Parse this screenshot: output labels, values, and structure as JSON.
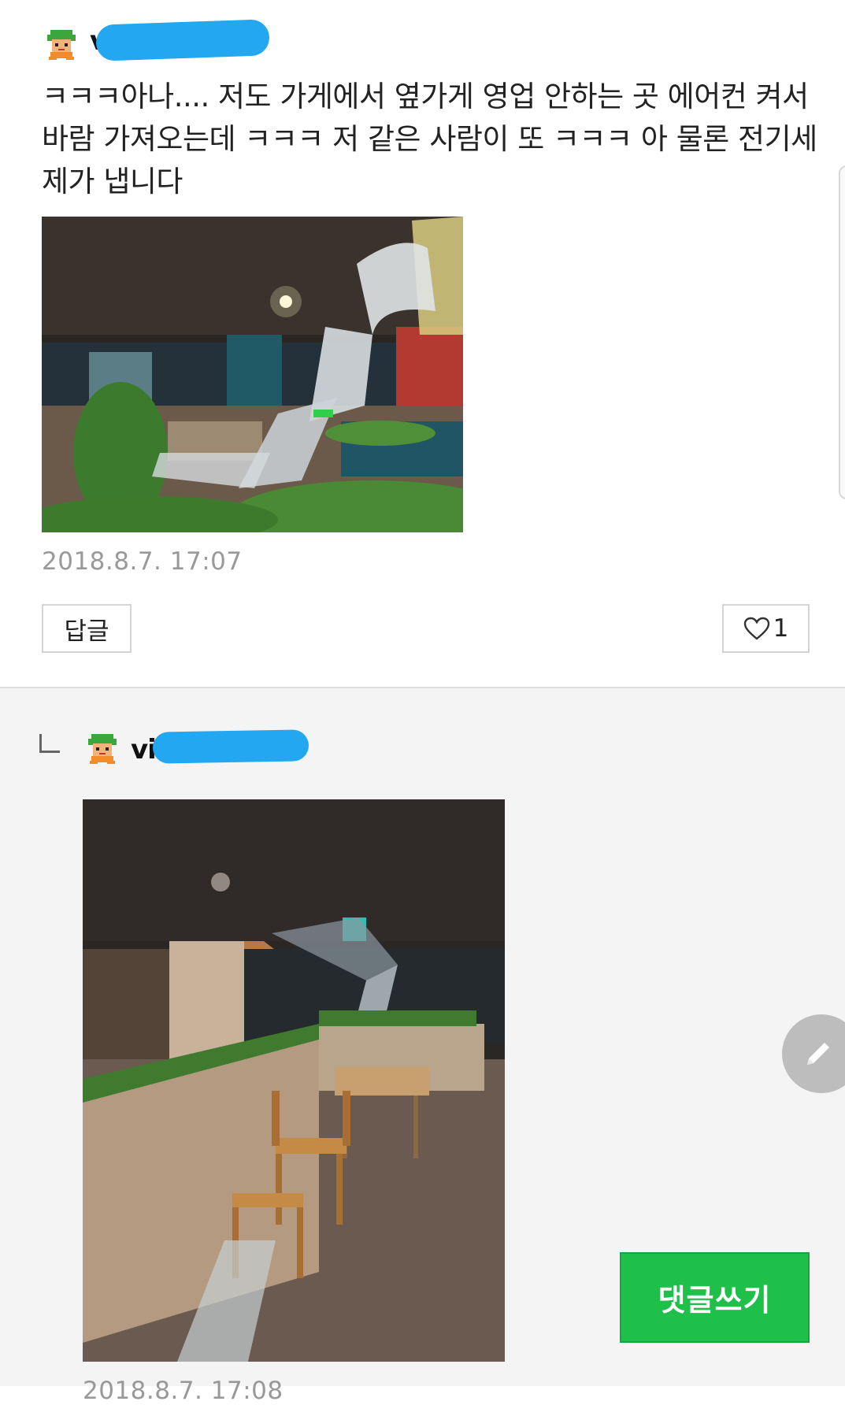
{
  "comments": [
    {
      "username": "vi",
      "text": "ㅋㅋㅋ아나.... 저도 가게에서 옆가게 영업 안하는 곳 에어컨 켜서 바람 가져오는데 ㅋㅋㅋ 저 같은 사람이 또 ㅋㅋㅋ 아 물론 전기세 제가 냅니다",
      "timestamp": "2018.8.7. 17:07",
      "reply_label": "답글",
      "like_count": "1"
    },
    {
      "username": "vi",
      "timestamp": "2018.8.7. 17:08"
    }
  ],
  "fab": {
    "icon": "pencil-icon"
  },
  "write_button_label": "댓글쓰기",
  "colors": {
    "accent_green": "#1ec04a",
    "redaction_blue": "#22a7f0"
  }
}
